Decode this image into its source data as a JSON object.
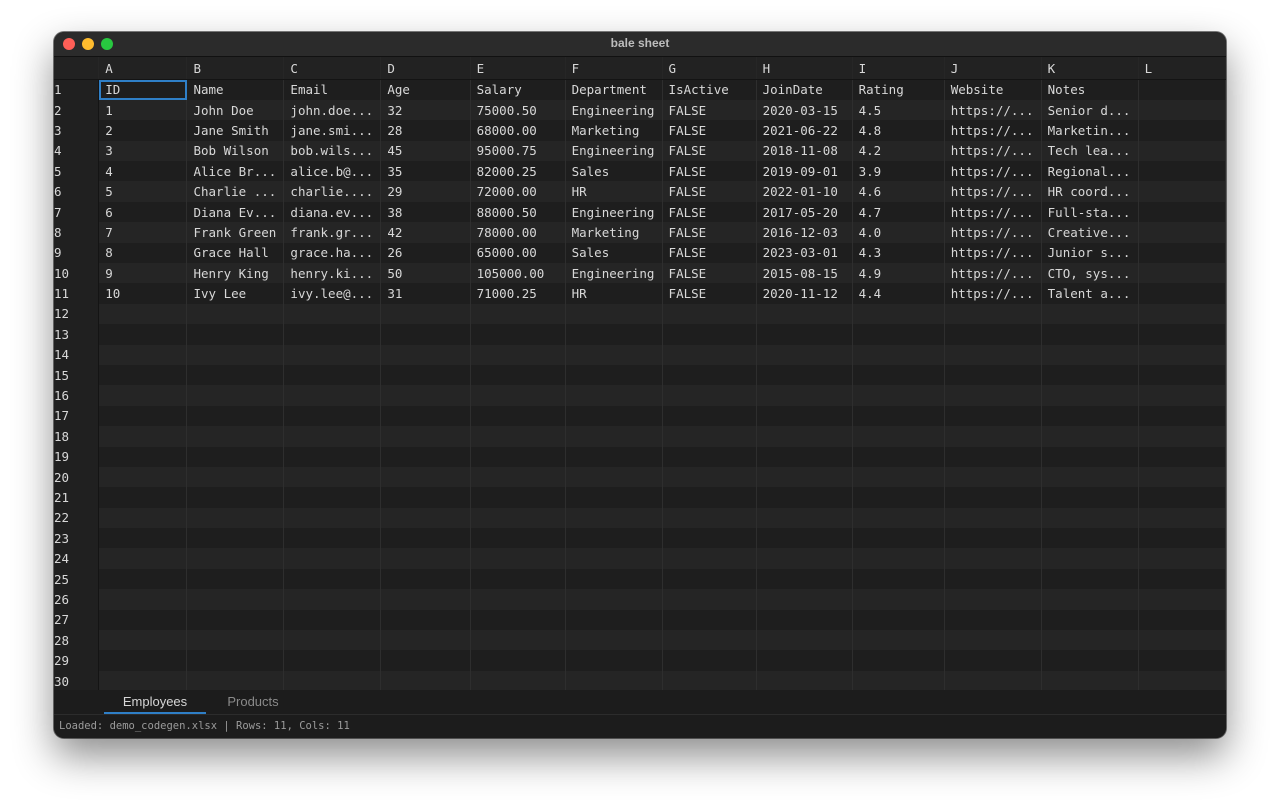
{
  "window": {
    "title": "bale sheet"
  },
  "sheet": {
    "columns": [
      "A",
      "B",
      "C",
      "D",
      "E",
      "F",
      "G",
      "H",
      "I",
      "J",
      "K",
      "L"
    ],
    "row_numbers": [
      "1",
      "2",
      "3",
      "4",
      "5",
      "6",
      "7",
      "8",
      "9",
      "10",
      "11",
      "12",
      "13",
      "14",
      "15",
      "16",
      "17",
      "18",
      "19",
      "20",
      "21",
      "22",
      "23",
      "24",
      "25",
      "26",
      "27",
      "28",
      "29",
      "30"
    ],
    "rows": [
      [
        "ID",
        "Name",
        "Email",
        "Age",
        "Salary",
        "Department",
        "IsActive",
        "JoinDate",
        "Rating",
        "Website",
        "Notes"
      ],
      [
        "1",
        "John Doe",
        "john.doe...",
        "32",
        "75000.50",
        "Engineering",
        "FALSE",
        "2020-03-15",
        "4.5",
        "https://...",
        "Senior d..."
      ],
      [
        "2",
        "Jane Smith",
        "jane.smi...",
        "28",
        "68000.00",
        "Marketing",
        "FALSE",
        "2021-06-22",
        "4.8",
        "https://...",
        "Marketin..."
      ],
      [
        "3",
        "Bob Wilson",
        "bob.wils...",
        "45",
        "95000.75",
        "Engineering",
        "FALSE",
        "2018-11-08",
        "4.2",
        "https://...",
        "Tech lea..."
      ],
      [
        "4",
        "Alice Br...",
        "alice.b@...",
        "35",
        "82000.25",
        "Sales",
        "FALSE",
        "2019-09-01",
        "3.9",
        "https://...",
        "Regional..."
      ],
      [
        "5",
        "Charlie ...",
        "charlie....",
        "29",
        "72000.00",
        "HR",
        "FALSE",
        "2022-01-10",
        "4.6",
        "https://...",
        "HR coord..."
      ],
      [
        "6",
        "Diana Ev...",
        "diana.ev...",
        "38",
        "88000.50",
        "Engineering",
        "FALSE",
        "2017-05-20",
        "4.7",
        "https://...",
        "Full-sta..."
      ],
      [
        "7",
        "Frank Green",
        "frank.gr...",
        "42",
        "78000.00",
        "Marketing",
        "FALSE",
        "2016-12-03",
        "4.0",
        "https://...",
        "Creative..."
      ],
      [
        "8",
        "Grace Hall",
        "grace.ha...",
        "26",
        "65000.00",
        "Sales",
        "FALSE",
        "2023-03-01",
        "4.3",
        "https://...",
        "Junior s..."
      ],
      [
        "9",
        "Henry King",
        "henry.ki...",
        "50",
        "105000.00",
        "Engineering",
        "FALSE",
        "2015-08-15",
        "4.9",
        "https://...",
        "CTO, sys..."
      ],
      [
        "10",
        "Ivy Lee",
        "ivy.lee@...",
        "31",
        "71000.25",
        "HR",
        "FALSE",
        "2020-11-12",
        "4.4",
        "https://...",
        "Talent a..."
      ]
    ]
  },
  "tabs": [
    {
      "label": "Employees",
      "active": true
    },
    {
      "label": "Products",
      "active": false
    }
  ],
  "status": {
    "text": "Loaded: demo_codegen.xlsx | Rows: 11, Cols: 11"
  },
  "colors": {
    "selection": "#2f7fc7",
    "close": "#ff5f57",
    "minimize": "#febc2e",
    "maximize": "#28c840"
  }
}
